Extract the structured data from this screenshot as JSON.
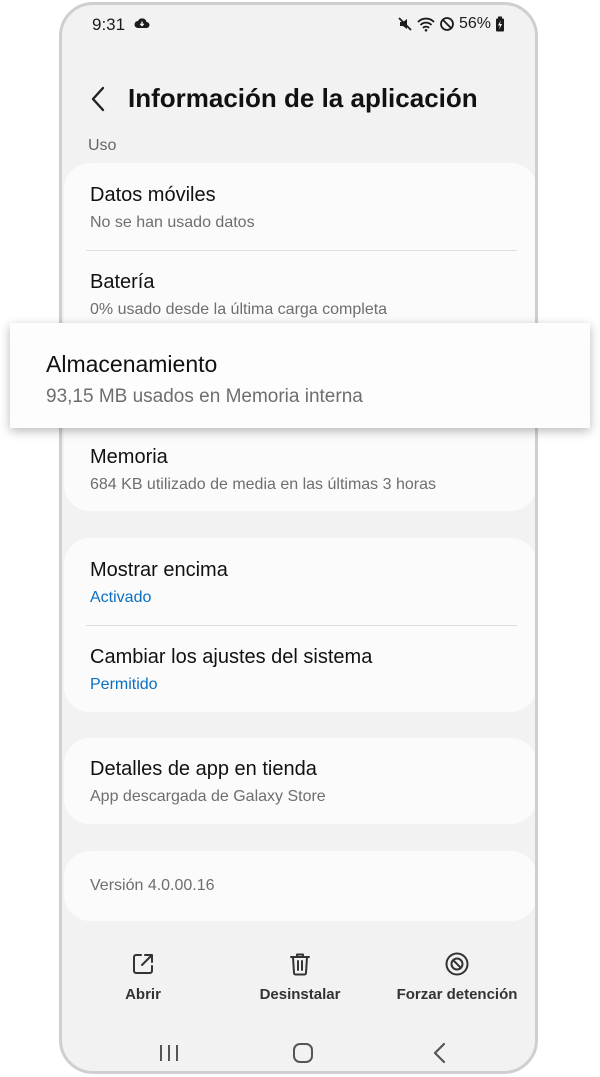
{
  "status_bar": {
    "time": "9:31",
    "battery_percent": "56%",
    "icons": [
      "cloud-sync-icon",
      "mute-icon",
      "wifi-icon",
      "do-not-disturb-icon",
      "battery-charging-icon"
    ]
  },
  "header": {
    "title": "Información de la aplicación"
  },
  "sections": {
    "usage_label": "Uso"
  },
  "usage_items": [
    {
      "title": "Datos móviles",
      "subtitle": "No se han usado datos"
    },
    {
      "title": "Batería",
      "subtitle": "0% usado desde la última carga completa"
    },
    {
      "title": "Almacenamiento",
      "subtitle": "93,15 MB usados en Memoria interna"
    },
    {
      "title": "Memoria",
      "subtitle": "684 KB utilizado de media en las últimas 3 horas"
    }
  ],
  "permission_items": [
    {
      "title": "Mostrar encima",
      "subtitle": "Activado"
    },
    {
      "title": "Cambiar los ajustes del sistema",
      "subtitle": "Permitido"
    }
  ],
  "store_item": {
    "title": "Detalles de app en tienda",
    "subtitle": "App descargada de Galaxy Store"
  },
  "version": "Versión 4.0.00.16",
  "actions": [
    {
      "label": "Abrir",
      "icon": "open-external-icon"
    },
    {
      "label": "Desinstalar",
      "icon": "trash-icon"
    },
    {
      "label": "Forzar detención",
      "icon": "force-stop-icon"
    }
  ],
  "nav_bar": {
    "buttons": [
      "recents-icon",
      "home-icon",
      "back-nav-icon"
    ]
  },
  "colors": {
    "accent_blue": "#0b6fc2",
    "background": "#f2f2f2",
    "card": "#fbfbfb"
  }
}
